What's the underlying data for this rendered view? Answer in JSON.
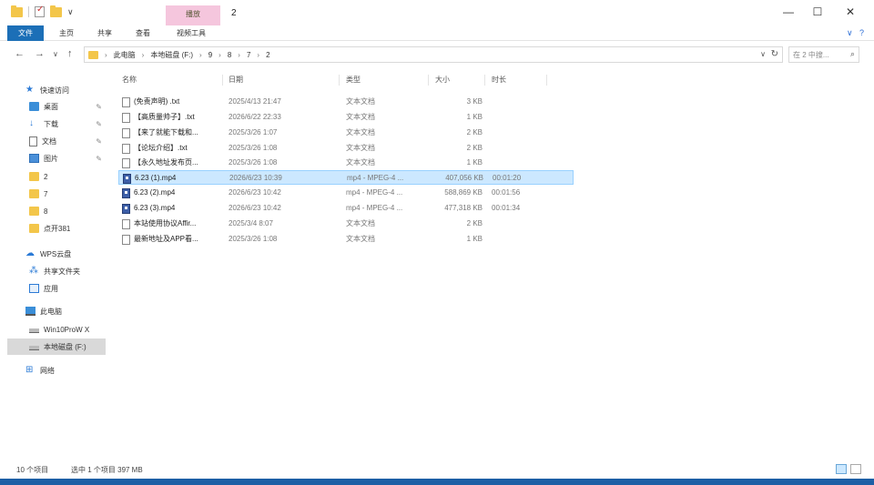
{
  "window": {
    "title": "2",
    "context_tab": "播放",
    "controls": {
      "minimize": "—",
      "maximize": "☐",
      "close": "✕"
    }
  },
  "ribbon": {
    "tabs": [
      "文件",
      "主页",
      "共享",
      "查看",
      "视频工具"
    ],
    "help": "?"
  },
  "address": {
    "back": "←",
    "forward": "→",
    "recent": "∨",
    "up": "↑",
    "crumbs": [
      "此电脑",
      "本地磁盘 (F:)",
      "9",
      "8",
      "7",
      "2"
    ],
    "dropdown": "∨",
    "refresh": "↻"
  },
  "search": {
    "placeholder": "在 2 中搜... ",
    "icon": "⌕"
  },
  "nav": {
    "items": [
      {
        "label": "快速访问",
        "icon": "star-icon",
        "pinned": false
      },
      {
        "label": "桌面",
        "icon": "desktop-icon",
        "pinned": true
      },
      {
        "label": "下载",
        "icon": "download-icon",
        "pinned": true
      },
      {
        "label": "文档",
        "icon": "document-icon",
        "pinned": true
      },
      {
        "label": "图片",
        "icon": "pictures-icon",
        "pinned": true
      },
      {
        "label": "2",
        "icon": "folder-icon",
        "pinned": false
      },
      {
        "label": "7",
        "icon": "folder-icon",
        "pinned": false
      },
      {
        "label": "8",
        "icon": "folder-icon",
        "pinned": false
      },
      {
        "label": "点开381",
        "icon": "folder-icon",
        "pinned": false
      },
      {
        "label": "WPS云盘",
        "icon": "cloud-icon",
        "pinned": false
      },
      {
        "label": "共享文件夹",
        "icon": "share-icon",
        "pinned": false
      },
      {
        "label": "应用",
        "icon": "app-icon",
        "pinned": false
      },
      {
        "label": "此电脑",
        "icon": "computer-icon",
        "pinned": false
      },
      {
        "label": "Win10ProW X",
        "icon": "drive-icon",
        "pinned": false
      },
      {
        "label": "本地磁盘 (F:)",
        "icon": "drive-icon",
        "pinned": false
      },
      {
        "label": "网络",
        "icon": "network-icon",
        "pinned": false
      }
    ],
    "pin_glyph": "📌"
  },
  "columns": {
    "name": "名称",
    "date": "日期",
    "type": "类型",
    "size": "大小",
    "duration": "时长"
  },
  "files": [
    {
      "name": "(免责声明) .txt",
      "date": "2025/4/13 21:47",
      "type": "文本文档",
      "size": "3 KB",
      "duration": "",
      "kind": "txt"
    },
    {
      "name": "【高质量帅子】.txt",
      "date": "2026/6/22 22:33",
      "type": "文本文档",
      "size": "1 KB",
      "duration": "",
      "kind": "txt"
    },
    {
      "name": "【来了就能下载和...",
      "date": "2025/3/26 1:07",
      "type": "文本文档",
      "size": "2 KB",
      "duration": "",
      "kind": "txt"
    },
    {
      "name": "【论坛介绍】.txt",
      "date": "2025/3/26 1:08",
      "type": "文本文档",
      "size": "2 KB",
      "duration": "",
      "kind": "txt"
    },
    {
      "name": "【永久地址发布页...",
      "date": "2025/3/26 1:08",
      "type": "文本文档",
      "size": "1 KB",
      "duration": "",
      "kind": "txt"
    },
    {
      "name": "6.23 (1).mp4",
      "date": "2026/6/23 10:39",
      "type": "mp4 - MPEG-4 ...",
      "size": "407,056 KB",
      "duration": "00:01:20",
      "kind": "mp4",
      "selected": true
    },
    {
      "name": "6.23 (2).mp4",
      "date": "2026/6/23 10:42",
      "type": "mp4 - MPEG-4 ...",
      "size": "588,869 KB",
      "duration": "00:01:56",
      "kind": "mp4"
    },
    {
      "name": "6.23 (3).mp4",
      "date": "2026/6/23 10:42",
      "type": "mp4 - MPEG-4 ...",
      "size": "477,318 KB",
      "duration": "00:01:34",
      "kind": "mp4"
    },
    {
      "name": "本站使用协议Affir...",
      "date": "2025/3/4 8:07",
      "type": "文本文档",
      "size": "2 KB",
      "duration": "",
      "kind": "txt"
    },
    {
      "name": "最新地址及APP看...",
      "date": "2025/3/26 1:08",
      "type": "文本文档",
      "size": "1 KB",
      "duration": "",
      "kind": "txt"
    }
  ],
  "status": {
    "count": "10 个项目",
    "selection": "选中 1 个项目  397 MB"
  }
}
